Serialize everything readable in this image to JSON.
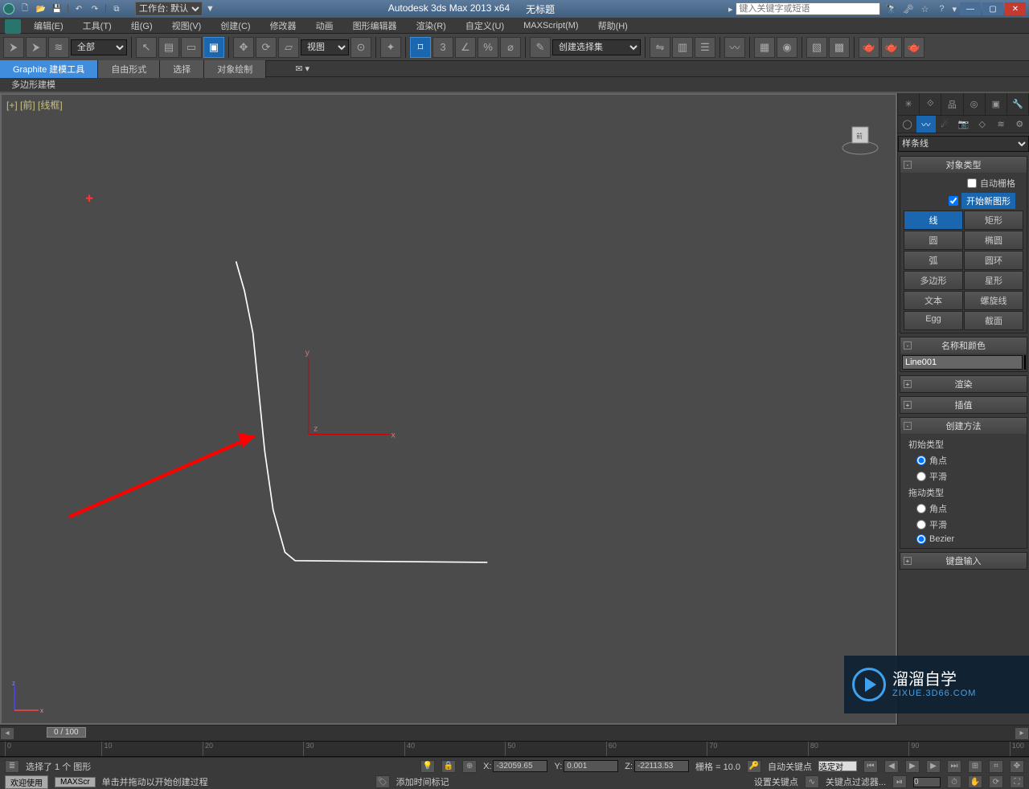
{
  "titlebar": {
    "workspace_label": "工作台: 默认",
    "app_title": "Autodesk 3ds Max  2013 x64",
    "doc_title": "无标题",
    "search_placeholder": "键入关键字或短语"
  },
  "menus": [
    "编辑(E)",
    "工具(T)",
    "组(G)",
    "视图(V)",
    "创建(C)",
    "修改器",
    "动画",
    "图形编辑器",
    "渲染(R)",
    "自定义(U)",
    "MAXScript(M)",
    "帮助(H)"
  ],
  "maintoolbar": {
    "selection_filter": "全部",
    "refcoord": "视图",
    "named_set": "创建选择集"
  },
  "ribbon": {
    "tabs": [
      "Graphite 建模工具",
      "自由形式",
      "选择",
      "对象绘制"
    ],
    "sub": "多边形建模"
  },
  "viewport": {
    "label": "[+] [前] [线框]"
  },
  "cmdpanel": {
    "category": "样条线",
    "rollouts": {
      "object_type": "对象类型",
      "auto_grid": "自动栅格",
      "start_new": "开始新图形",
      "name_color": "名称和颜色",
      "render": "渲染",
      "interp": "插值",
      "method": "创建方法",
      "initial_type": "初始类型",
      "drag_type": "拖动类型",
      "kbd": "键盘输入"
    },
    "objects": [
      "线",
      "矩形",
      "圆",
      "椭圆",
      "弧",
      "圆环",
      "多边形",
      "星形",
      "文本",
      "螺旋线",
      "Egg",
      "截面"
    ],
    "name_value": "Line001",
    "radio_corner": "角点",
    "radio_smooth": "平滑",
    "radio_bezier": "Bezier"
  },
  "timeline": {
    "frame_display": "0 / 100"
  },
  "status": {
    "selection": "选择了 1 个 图形",
    "x": "-32059.65",
    "y": "0.001",
    "z": "-22113.53",
    "grid": "栅格 = 10.0",
    "autokey": "自动关键点",
    "selected": "选定对",
    "prompt": "单击并拖动以开始创建过程",
    "add_time_tag": "添加时间标记",
    "set_key": "设置关键点",
    "key_filter": "关键点过滤器...",
    "welcome": "欢迎使用",
    "maxscr": "MAXScr"
  },
  "watermark": {
    "title": "溜溜自学",
    "url": "ZIXUE.3D66.COM"
  }
}
